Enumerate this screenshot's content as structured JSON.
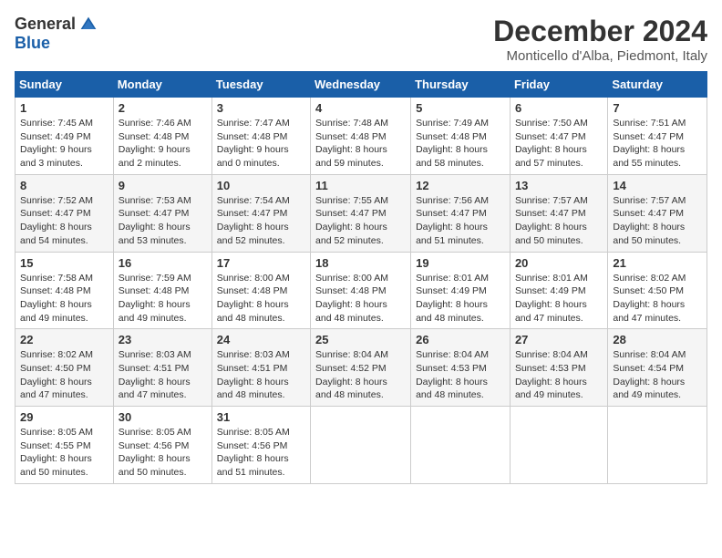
{
  "logo": {
    "general": "General",
    "blue": "Blue"
  },
  "title": "December 2024",
  "location": "Monticello d'Alba, Piedmont, Italy",
  "days_of_week": [
    "Sunday",
    "Monday",
    "Tuesday",
    "Wednesday",
    "Thursday",
    "Friday",
    "Saturday"
  ],
  "weeks": [
    [
      {
        "day": "1",
        "sunrise": "7:45 AM",
        "sunset": "4:49 PM",
        "daylight": "9 hours and 3 minutes."
      },
      {
        "day": "2",
        "sunrise": "7:46 AM",
        "sunset": "4:48 PM",
        "daylight": "9 hours and 2 minutes."
      },
      {
        "day": "3",
        "sunrise": "7:47 AM",
        "sunset": "4:48 PM",
        "daylight": "9 hours and 0 minutes."
      },
      {
        "day": "4",
        "sunrise": "7:48 AM",
        "sunset": "4:48 PM",
        "daylight": "8 hours and 59 minutes."
      },
      {
        "day": "5",
        "sunrise": "7:49 AM",
        "sunset": "4:48 PM",
        "daylight": "8 hours and 58 minutes."
      },
      {
        "day": "6",
        "sunrise": "7:50 AM",
        "sunset": "4:47 PM",
        "daylight": "8 hours and 57 minutes."
      },
      {
        "day": "7",
        "sunrise": "7:51 AM",
        "sunset": "4:47 PM",
        "daylight": "8 hours and 55 minutes."
      }
    ],
    [
      {
        "day": "8",
        "sunrise": "7:52 AM",
        "sunset": "4:47 PM",
        "daylight": "8 hours and 54 minutes."
      },
      {
        "day": "9",
        "sunrise": "7:53 AM",
        "sunset": "4:47 PM",
        "daylight": "8 hours and 53 minutes."
      },
      {
        "day": "10",
        "sunrise": "7:54 AM",
        "sunset": "4:47 PM",
        "daylight": "8 hours and 52 minutes."
      },
      {
        "day": "11",
        "sunrise": "7:55 AM",
        "sunset": "4:47 PM",
        "daylight": "8 hours and 52 minutes."
      },
      {
        "day": "12",
        "sunrise": "7:56 AM",
        "sunset": "4:47 PM",
        "daylight": "8 hours and 51 minutes."
      },
      {
        "day": "13",
        "sunrise": "7:57 AM",
        "sunset": "4:47 PM",
        "daylight": "8 hours and 50 minutes."
      },
      {
        "day": "14",
        "sunrise": "7:57 AM",
        "sunset": "4:47 PM",
        "daylight": "8 hours and 50 minutes."
      }
    ],
    [
      {
        "day": "15",
        "sunrise": "7:58 AM",
        "sunset": "4:48 PM",
        "daylight": "8 hours and 49 minutes."
      },
      {
        "day": "16",
        "sunrise": "7:59 AM",
        "sunset": "4:48 PM",
        "daylight": "8 hours and 49 minutes."
      },
      {
        "day": "17",
        "sunrise": "8:00 AM",
        "sunset": "4:48 PM",
        "daylight": "8 hours and 48 minutes."
      },
      {
        "day": "18",
        "sunrise": "8:00 AM",
        "sunset": "4:48 PM",
        "daylight": "8 hours and 48 minutes."
      },
      {
        "day": "19",
        "sunrise": "8:01 AM",
        "sunset": "4:49 PM",
        "daylight": "8 hours and 48 minutes."
      },
      {
        "day": "20",
        "sunrise": "8:01 AM",
        "sunset": "4:49 PM",
        "daylight": "8 hours and 47 minutes."
      },
      {
        "day": "21",
        "sunrise": "8:02 AM",
        "sunset": "4:50 PM",
        "daylight": "8 hours and 47 minutes."
      }
    ],
    [
      {
        "day": "22",
        "sunrise": "8:02 AM",
        "sunset": "4:50 PM",
        "daylight": "8 hours and 47 minutes."
      },
      {
        "day": "23",
        "sunrise": "8:03 AM",
        "sunset": "4:51 PM",
        "daylight": "8 hours and 47 minutes."
      },
      {
        "day": "24",
        "sunrise": "8:03 AM",
        "sunset": "4:51 PM",
        "daylight": "8 hours and 48 minutes."
      },
      {
        "day": "25",
        "sunrise": "8:04 AM",
        "sunset": "4:52 PM",
        "daylight": "8 hours and 48 minutes."
      },
      {
        "day": "26",
        "sunrise": "8:04 AM",
        "sunset": "4:53 PM",
        "daylight": "8 hours and 48 minutes."
      },
      {
        "day": "27",
        "sunrise": "8:04 AM",
        "sunset": "4:53 PM",
        "daylight": "8 hours and 49 minutes."
      },
      {
        "day": "28",
        "sunrise": "8:04 AM",
        "sunset": "4:54 PM",
        "daylight": "8 hours and 49 minutes."
      }
    ],
    [
      {
        "day": "29",
        "sunrise": "8:05 AM",
        "sunset": "4:55 PM",
        "daylight": "8 hours and 50 minutes."
      },
      {
        "day": "30",
        "sunrise": "8:05 AM",
        "sunset": "4:56 PM",
        "daylight": "8 hours and 50 minutes."
      },
      {
        "day": "31",
        "sunrise": "8:05 AM",
        "sunset": "4:56 PM",
        "daylight": "8 hours and 51 minutes."
      },
      null,
      null,
      null,
      null
    ]
  ]
}
